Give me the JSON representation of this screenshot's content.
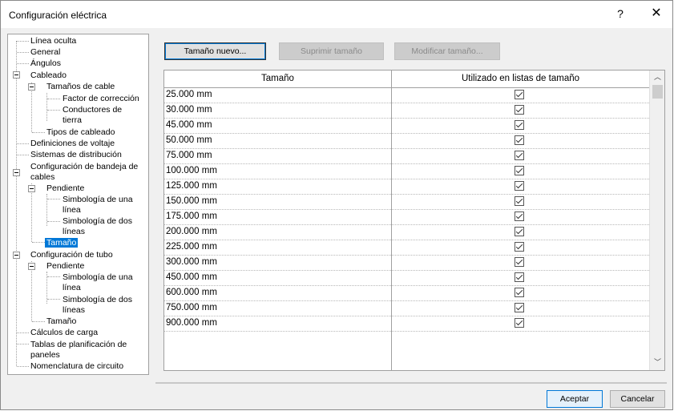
{
  "window": {
    "title": "Configuración eléctrica",
    "help_glyph": "?",
    "close_glyph": "✕"
  },
  "tree": {
    "items": [
      {
        "label": "Línea oculta"
      },
      {
        "label": "General"
      },
      {
        "label": "Ángulos"
      },
      {
        "label": "Cableado"
      },
      {
        "label": "Tamaños de cable"
      },
      {
        "label": "Factor de corrección"
      },
      {
        "label": "Conductores de"
      },
      {
        "label": "tierra"
      },
      {
        "label": "Tipos de cableado"
      },
      {
        "label": "Definiciones de voltaje"
      },
      {
        "label": "Sistemas de distribución"
      },
      {
        "label": "Configuración de bandeja de"
      },
      {
        "label": "cables"
      },
      {
        "label": "Pendiente"
      },
      {
        "label": "Simbología de una"
      },
      {
        "label": "línea"
      },
      {
        "label": "Simbología de dos"
      },
      {
        "label": "líneas"
      },
      {
        "label": "Tamaño"
      },
      {
        "label": "Configuración de tubo"
      },
      {
        "label": "Pendiente"
      },
      {
        "label": "Simbología de una"
      },
      {
        "label": "línea"
      },
      {
        "label": "Simbología de dos"
      },
      {
        "label": "líneas"
      },
      {
        "label": "Tamaño"
      },
      {
        "label": "Cálculos de carga"
      },
      {
        "label": "Tablas de planificación de"
      },
      {
        "label": "paneles"
      },
      {
        "label": "Nomenclatura de circuito"
      }
    ]
  },
  "toolbar": {
    "new_size": "Tamaño nuevo...",
    "delete_size": "Suprimir tamaño",
    "modify_size": "Modificar tamaño..."
  },
  "table": {
    "columns": [
      "Tamaño",
      "Utilizado en listas de tamaño"
    ],
    "rows": [
      {
        "size": "25.000 mm",
        "used": true
      },
      {
        "size": "30.000 mm",
        "used": true
      },
      {
        "size": "45.000 mm",
        "used": true
      },
      {
        "size": "50.000 mm",
        "used": true
      },
      {
        "size": "75.000 mm",
        "used": true
      },
      {
        "size": "100.000 mm",
        "used": true
      },
      {
        "size": "125.000 mm",
        "used": true
      },
      {
        "size": "150.000 mm",
        "used": true
      },
      {
        "size": "175.000 mm",
        "used": true
      },
      {
        "size": "200.000 mm",
        "used": true
      },
      {
        "size": "225.000 mm",
        "used": true
      },
      {
        "size": "300.000 mm",
        "used": true
      },
      {
        "size": "450.000 mm",
        "used": true
      },
      {
        "size": "600.000 mm",
        "used": true
      },
      {
        "size": "750.000 mm",
        "used": true
      },
      {
        "size": "900.000 mm",
        "used": true
      }
    ]
  },
  "footer": {
    "ok": "Aceptar",
    "cancel": "Cancelar"
  },
  "colors": {
    "selection": "#0078d7",
    "dialog_bg": "#f0f0f0"
  }
}
